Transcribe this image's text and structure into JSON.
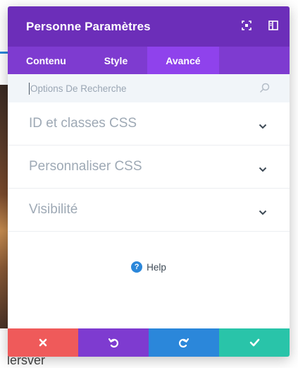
{
  "modal": {
    "title": "Personne Paramètres",
    "header_icons": [
      "fullscreen-icon",
      "sidebar-layout-icon"
    ]
  },
  "tabs": [
    {
      "label": "Contenu",
      "active": false
    },
    {
      "label": "Style",
      "active": false
    },
    {
      "label": "Avancé",
      "active": true
    }
  ],
  "search": {
    "placeholder": "Options De Recherche",
    "value": ""
  },
  "sections": [
    {
      "label": "ID et classes CSS"
    },
    {
      "label": "Personnaliser CSS"
    },
    {
      "label": "Visibilité"
    }
  ],
  "help": {
    "glyph": "?",
    "label": "Help"
  },
  "footer": {
    "buttons": [
      {
        "name": "discard",
        "icon": "close-icon",
        "color": "#ef5a5a"
      },
      {
        "name": "undo",
        "icon": "undo-icon",
        "color": "#7e3bd0"
      },
      {
        "name": "redo",
        "icon": "redo-icon",
        "color": "#2b87da"
      },
      {
        "name": "save",
        "icon": "check-icon",
        "color": "#29c4a9"
      }
    ]
  },
  "background": {
    "text": "lersver"
  },
  "colors": {
    "header": "#6c2eb9",
    "tabs": "#7e3bd0",
    "active_tab": "#8f42ec",
    "search_bg": "#f1f5f9",
    "help_accent": "#2b87da"
  }
}
